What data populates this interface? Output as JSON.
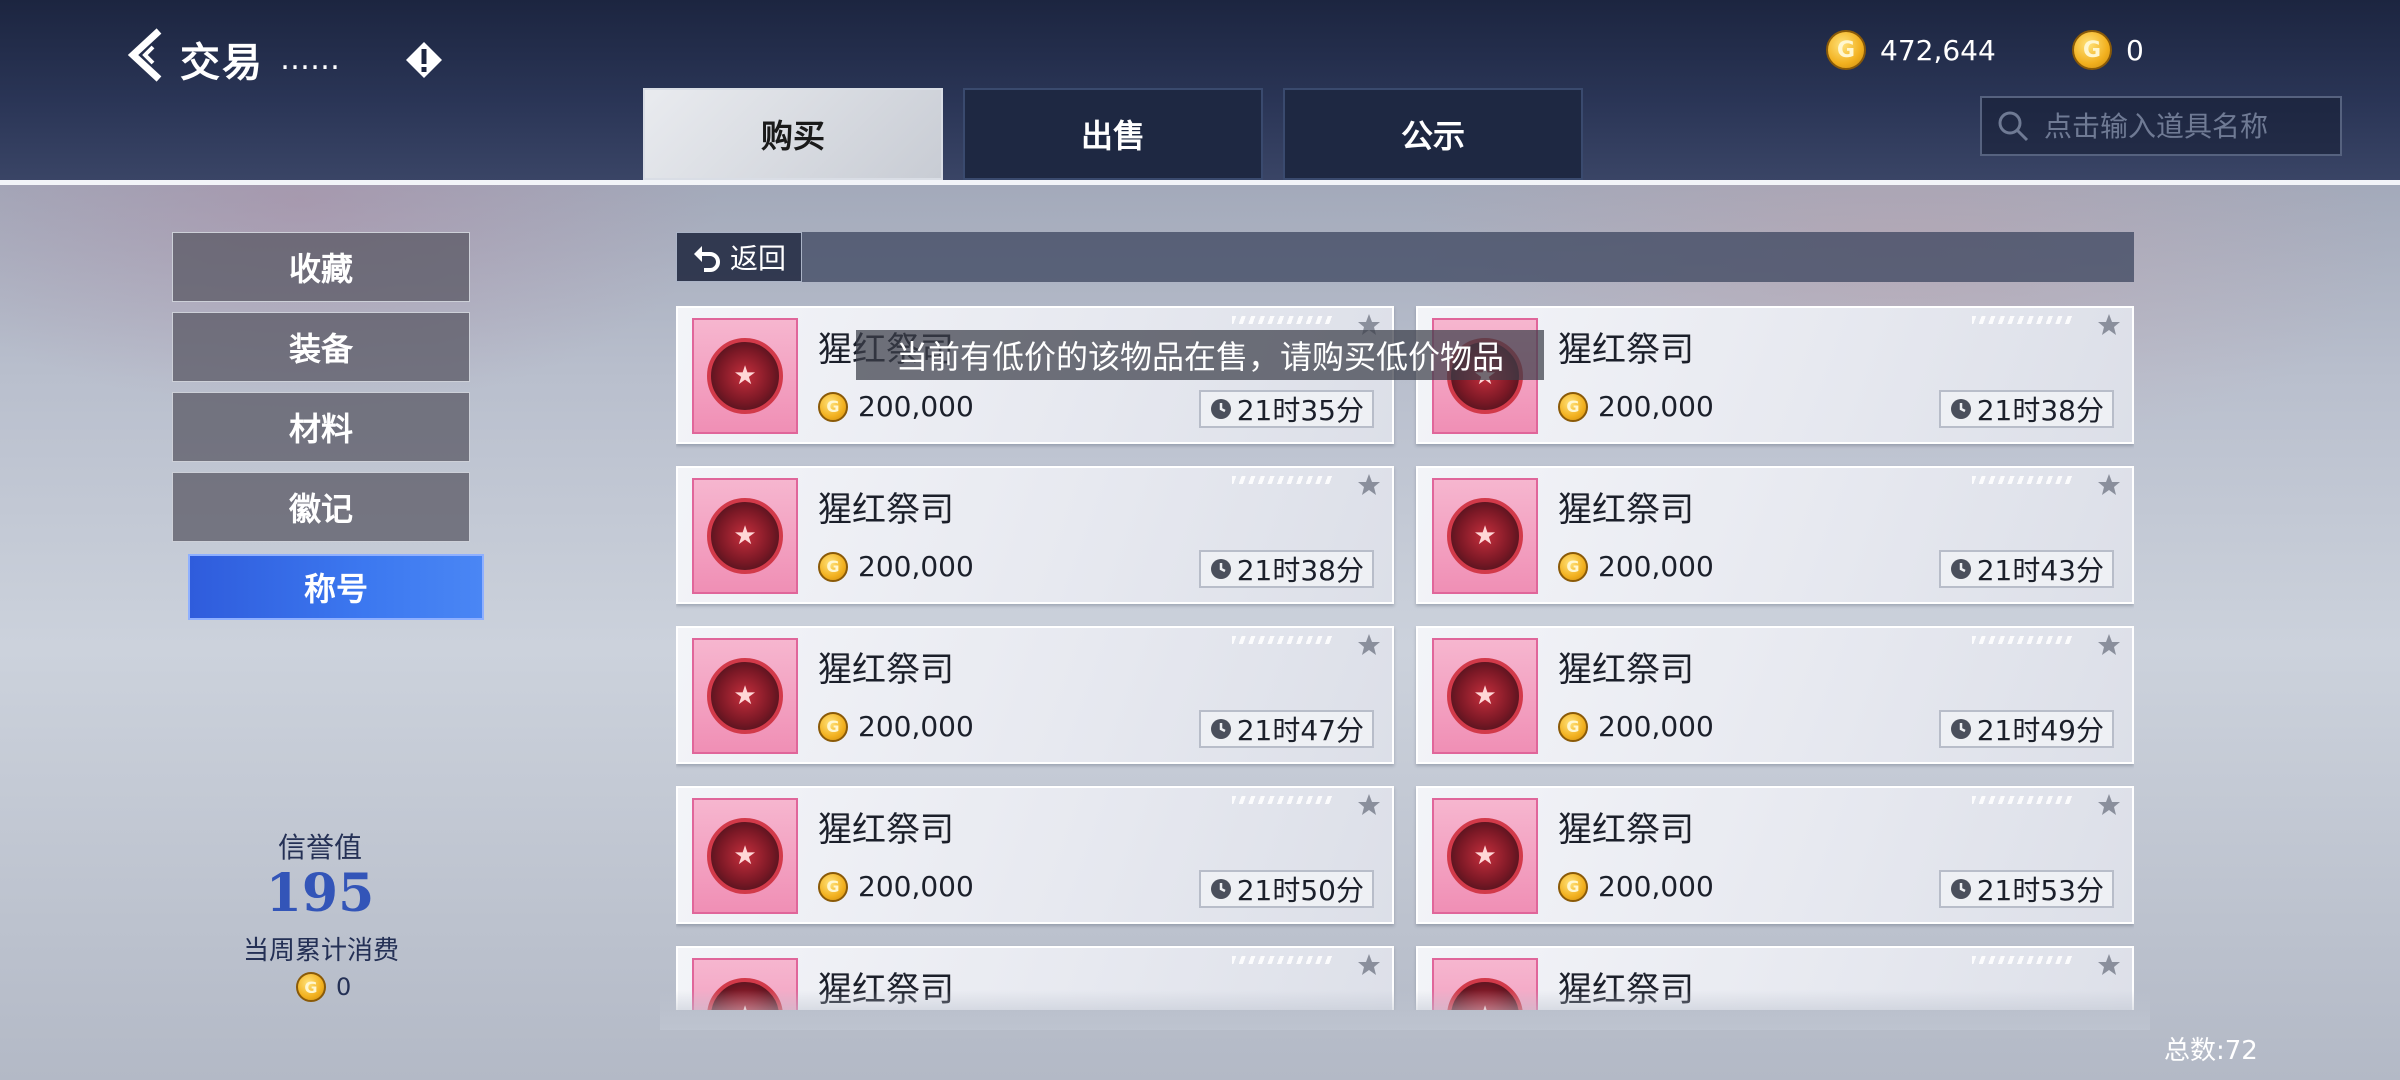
{
  "header": {
    "title": "交易",
    "title_dots": "……",
    "gold_amount": "472,644",
    "secondary_currency_amount": "0",
    "coin_glyph": "G"
  },
  "tabs": [
    {
      "label": "购买",
      "active": true
    },
    {
      "label": "出售",
      "active": false
    },
    {
      "label": "公示",
      "active": false
    }
  ],
  "search": {
    "placeholder": "点击输入道具名称",
    "value": ""
  },
  "sidebar": {
    "items": [
      {
        "label": "收藏",
        "active": false
      },
      {
        "label": "装备",
        "active": false
      },
      {
        "label": "材料",
        "active": false
      },
      {
        "label": "徽记",
        "active": false
      },
      {
        "label": "称号",
        "active": true
      }
    ]
  },
  "reputation": {
    "label": "信誉值",
    "value": "195",
    "weekly_label": "当周累计消费",
    "weekly_value": "0"
  },
  "content": {
    "return_label": "返回",
    "tooltip": "当前有低价的该物品在售，请购买低价物品",
    "total_label": "总数:72"
  },
  "items": [
    {
      "name": "猩红祭司",
      "price": "200,000",
      "time": "21时35分"
    },
    {
      "name": "猩红祭司",
      "price": "200,000",
      "time": "21时38分"
    },
    {
      "name": "猩红祭司",
      "price": "200,000",
      "time": "21时38分"
    },
    {
      "name": "猩红祭司",
      "price": "200,000",
      "time": "21时43分"
    },
    {
      "name": "猩红祭司",
      "price": "200,000",
      "time": "21时47分"
    },
    {
      "name": "猩红祭司",
      "price": "200,000",
      "time": "21时49分"
    },
    {
      "name": "猩红祭司",
      "price": "200,000",
      "time": "21时50分"
    },
    {
      "name": "猩红祭司",
      "price": "200,000",
      "time": "21时53分"
    },
    {
      "name": "猩红祭司",
      "price": "",
      "time": ""
    },
    {
      "name": "猩红祭司",
      "price": "",
      "time": ""
    }
  ],
  "colors": {
    "accent_blue": "#3c78f0",
    "header_bg": "#1c2540",
    "thumb_pink": "#f08fb5",
    "coin_gold": "#f2b01e"
  }
}
